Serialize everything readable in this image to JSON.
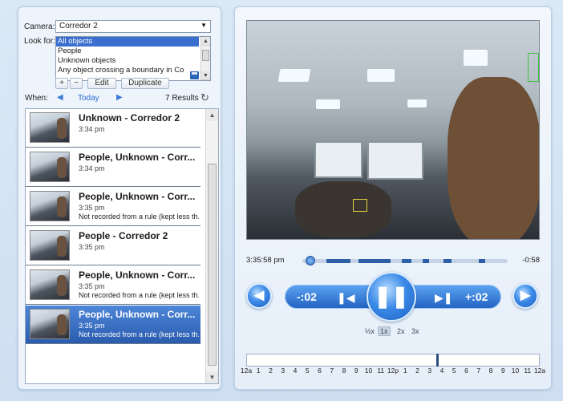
{
  "left": {
    "camera_label": "Camera:",
    "camera_value": "Corredor 2",
    "lookfor_label": "Look for:",
    "lookfor_items": [
      "All objects",
      "People",
      "Unknown objects",
      "Any object crossing a boundary in Corr..."
    ],
    "add_btn": "+",
    "remove_btn": "−",
    "edit_btn": "Edit",
    "duplicate_btn": "Duplicate",
    "when_label": "When:",
    "when_value": "Today",
    "results_count": "7 Results",
    "results": [
      {
        "title": "Unknown - Corredor 2",
        "time": "3:34 pm",
        "note": ""
      },
      {
        "title": "People, Unknown - Corr...",
        "time": "3:34 pm",
        "note": ""
      },
      {
        "title": "People, Unknown - Corr...",
        "time": "3:35 pm",
        "note": "Not recorded from a rule (kept less th..."
      },
      {
        "title": "People - Corredor 2",
        "time": "3:35 pm",
        "note": ""
      },
      {
        "title": "People, Unknown - Corr...",
        "time": "3:35 pm",
        "note": "Not recorded from a rule (kept less th..."
      },
      {
        "title": "People, Unknown - Corr...",
        "time": "3:35 pm",
        "note": "Not recorded from a rule (kept less th..."
      }
    ],
    "selected_result": 5
  },
  "player": {
    "current_time": "3:35:58 pm",
    "remaining": "-0:58",
    "skip_back": "-:02",
    "skip_forward": "+:02",
    "speeds": [
      "½x",
      "1x",
      "2x",
      "3x"
    ],
    "active_speed": "1x",
    "playhead_fraction": 0.04
  },
  "timeline": {
    "hours": [
      "12a",
      "1",
      "2",
      "3",
      "4",
      "5",
      "6",
      "7",
      "8",
      "9",
      "10",
      "11",
      "12p",
      "1",
      "2",
      "3",
      "4",
      "5",
      "6",
      "7",
      "8",
      "9",
      "10",
      "11",
      "12a"
    ]
  },
  "colors": {
    "accent": "#2b5cae",
    "selected_row": "#3a6fd0"
  }
}
